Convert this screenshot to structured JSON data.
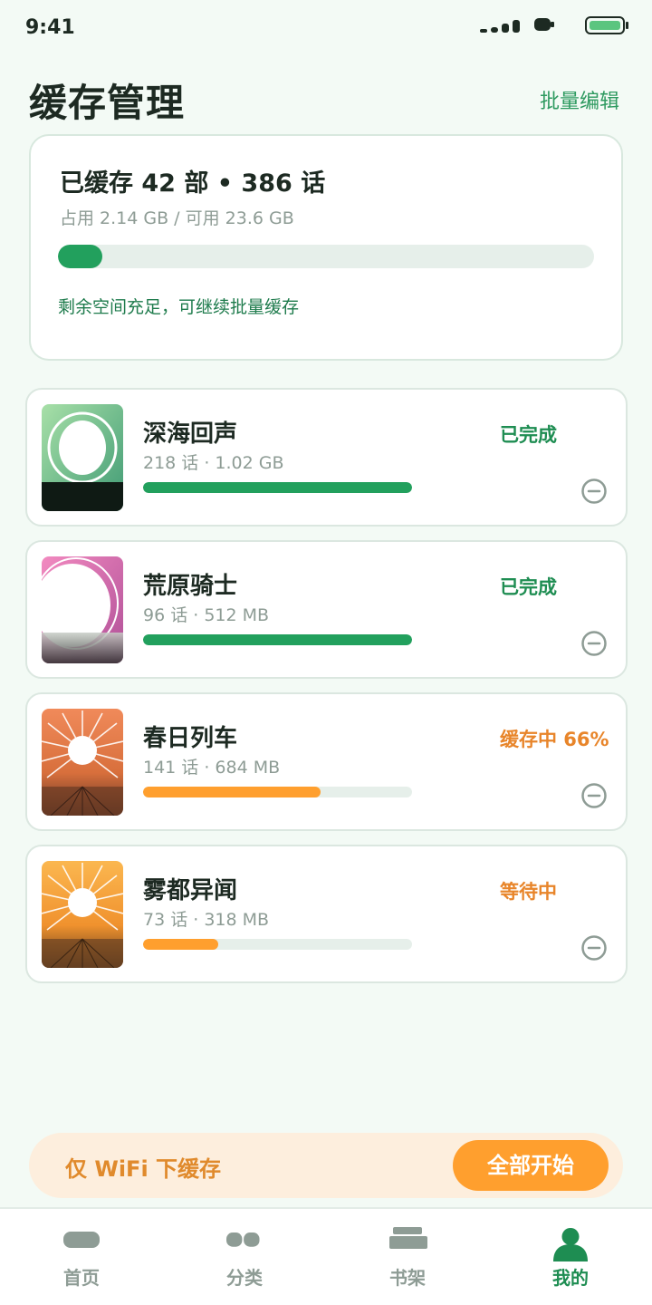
{
  "status_bar": {
    "time": "9:41"
  },
  "header": {
    "title": "缓存管理",
    "batch_edit": "批量编辑"
  },
  "summary": {
    "headline": "已缓存 42 部 • 386 话",
    "usage": "占用 2.14 GB / 可用 23.6 GB",
    "used_fraction": 0.083,
    "note": "剩余空间充足，可继续批量缓存",
    "accent_color": "#22a05d"
  },
  "downloads": [
    {
      "title": "深海回声",
      "meta": "218 话 · 1.02 GB",
      "status": "已完成",
      "progress": 1.0,
      "status_color": "#1e8d52",
      "bar_color": "#22a05d"
    },
    {
      "title": "荒原骑士",
      "meta": "96 话 · 512 MB",
      "status": "已完成",
      "progress": 1.0,
      "status_color": "#1e8d52",
      "bar_color": "#22a05d"
    },
    {
      "title": "春日列车",
      "meta": "141 话 · 684 MB",
      "status": "缓存中 66%",
      "progress": 0.66,
      "status_color": "#e8852a",
      "bar_color": "#ff9f2e"
    },
    {
      "title": "雾都异闻",
      "meta": "73 话 · 318 MB",
      "status": "等待中",
      "progress": 0.28,
      "status_color": "#e8852a",
      "bar_color": "#ff9f2e"
    }
  ],
  "action_bar": {
    "wifi_only": "仅 WiFi 下缓存",
    "start_all": "全部开始"
  },
  "nav": {
    "items": [
      {
        "label": "首页",
        "icon": "home-icon"
      },
      {
        "label": "分类",
        "icon": "category-icon"
      },
      {
        "label": "书架",
        "icon": "bookshelf-icon"
      },
      {
        "label": "我的",
        "icon": "profile-icon"
      }
    ],
    "active_index": 3
  }
}
